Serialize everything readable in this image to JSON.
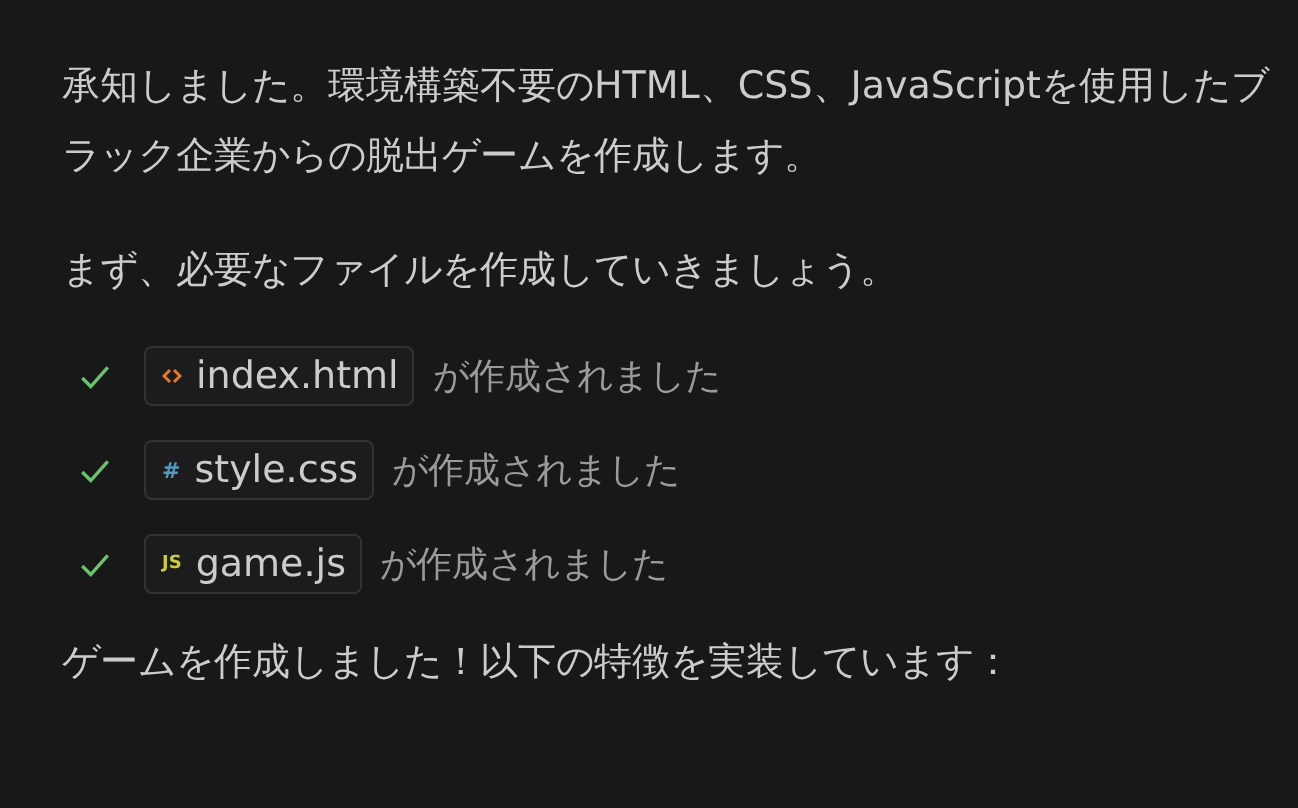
{
  "paragraphs": [
    "承知しました。環境構築不要のHTML、CSS、JavaScriptを使用したブラック企業からの脱出ゲームを作成します。",
    "まず、必要なファイルを作成していきましょう。"
  ],
  "files": [
    {
      "kind": "html",
      "name": "index.html",
      "status": "が作成されました",
      "done": true
    },
    {
      "kind": "css",
      "icon": "#",
      "name": "style.css",
      "status": "が作成されました",
      "done": true
    },
    {
      "kind": "js",
      "icon": "JS",
      "name": "game.js",
      "status": "が作成されました",
      "done": true
    }
  ],
  "closing": "ゲームを作成しました！以下の特徴を実装しています："
}
